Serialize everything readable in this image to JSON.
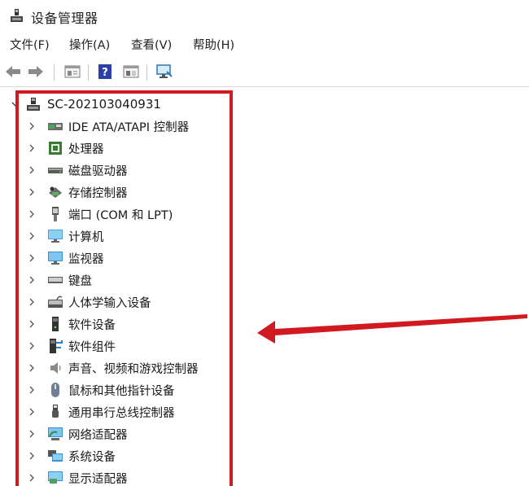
{
  "window": {
    "title": "设备管理器",
    "title_icon": "device-manager-icon"
  },
  "menu": {
    "items": [
      {
        "label": "文件(F)"
      },
      {
        "label": "操作(A)"
      },
      {
        "label": "查看(V)"
      },
      {
        "label": "帮助(H)"
      }
    ]
  },
  "toolbar": {
    "buttons": [
      {
        "icon": "back-arrow-icon"
      },
      {
        "icon": "forward-arrow-icon"
      },
      {
        "icon": "properties-icon"
      },
      {
        "icon": "help-icon"
      },
      {
        "icon": "show-hide-icon"
      },
      {
        "icon": "scan-hardware-icon"
      }
    ]
  },
  "tree": {
    "root": {
      "label": "SC-202103040931",
      "icon": "computer-tower-icon"
    },
    "nodes": [
      {
        "label": "IDE ATA/ATAPI 控制器",
        "icon": "ide-controller-icon"
      },
      {
        "label": "处理器",
        "icon": "processor-icon"
      },
      {
        "label": "磁盘驱动器",
        "icon": "disk-drive-icon"
      },
      {
        "label": "存储控制器",
        "icon": "storage-controller-icon"
      },
      {
        "label": "端口 (COM 和 LPT)",
        "icon": "port-icon"
      },
      {
        "label": "计算机",
        "icon": "computer-icon"
      },
      {
        "label": "监视器",
        "icon": "monitor-icon"
      },
      {
        "label": "键盘",
        "icon": "keyboard-icon"
      },
      {
        "label": "人体学输入设备",
        "icon": "hid-icon"
      },
      {
        "label": "软件设备",
        "icon": "software-device-icon"
      },
      {
        "label": "软件组件",
        "icon": "software-component-icon"
      },
      {
        "label": "声音、视频和游戏控制器",
        "icon": "sound-icon"
      },
      {
        "label": "鼠标和其他指针设备",
        "icon": "mouse-icon"
      },
      {
        "label": "通用串行总线控制器",
        "icon": "usb-icon"
      },
      {
        "label": "网络适配器",
        "icon": "network-adapter-icon"
      },
      {
        "label": "系统设备",
        "icon": "system-device-icon"
      },
      {
        "label": "显示适配器",
        "icon": "display-adapter-icon"
      }
    ]
  },
  "annotation": {
    "color": "#d11a1f"
  }
}
